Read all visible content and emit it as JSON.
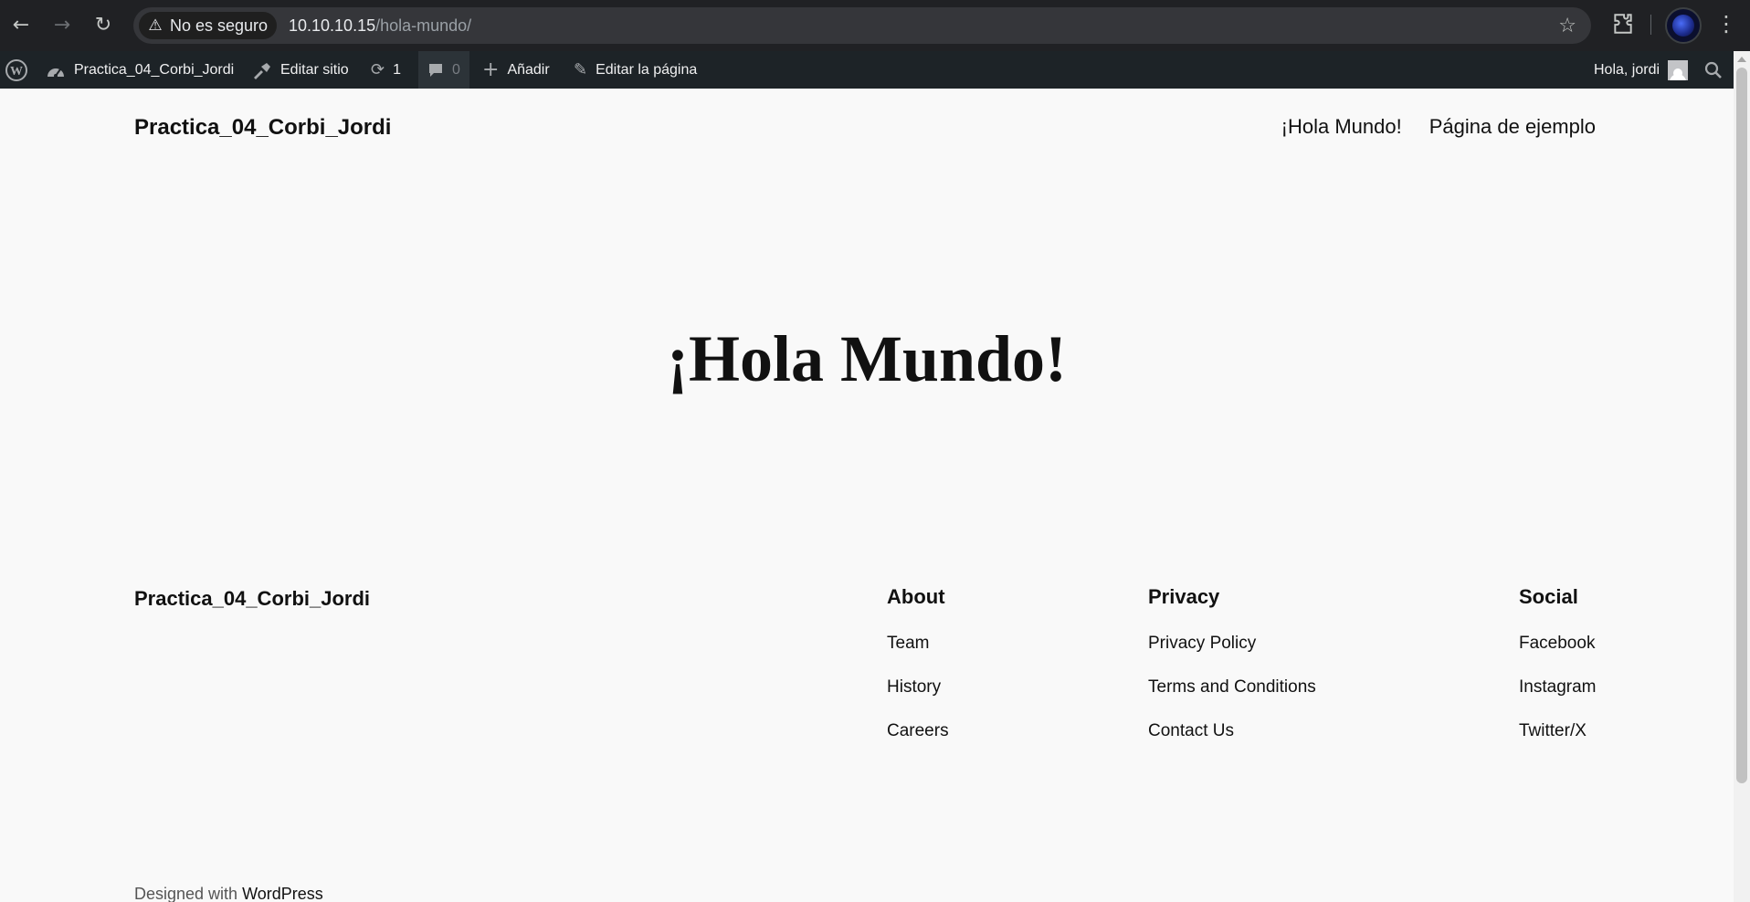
{
  "browser": {
    "security_label": "No es seguro",
    "url_host": "10.10.10.15",
    "url_path": "/hola-mundo/"
  },
  "adminbar": {
    "site_name": "Practica_04_Corbi_Jordi",
    "edit_site": "Editar sitio",
    "updates_count": "1",
    "comments_count": "0",
    "add_new": "Añadir",
    "edit_page": "Editar la página",
    "greeting": "Hola, jordi"
  },
  "header": {
    "site_title": "Practica_04_Corbi_Jordi",
    "nav": [
      "¡Hola Mundo!",
      "Página de ejemplo"
    ]
  },
  "main": {
    "title": "¡Hola Mundo!"
  },
  "footer": {
    "site_title": "Practica_04_Corbi_Jordi",
    "columns": [
      {
        "heading": "About",
        "links": [
          "Team",
          "History",
          "Careers"
        ]
      },
      {
        "heading": "Privacy",
        "links": [
          "Privacy Policy",
          "Terms and Conditions",
          "Contact Us"
        ]
      },
      {
        "heading": "Social",
        "links": [
          "Facebook",
          "Instagram",
          "Twitter/X"
        ]
      }
    ],
    "credit_prefix": "Designed with",
    "credit_link": "WordPress"
  },
  "colors": {
    "chrome_bg": "#202124",
    "adminbar_bg": "#1d2327",
    "page_bg": "#f9f9f9"
  }
}
